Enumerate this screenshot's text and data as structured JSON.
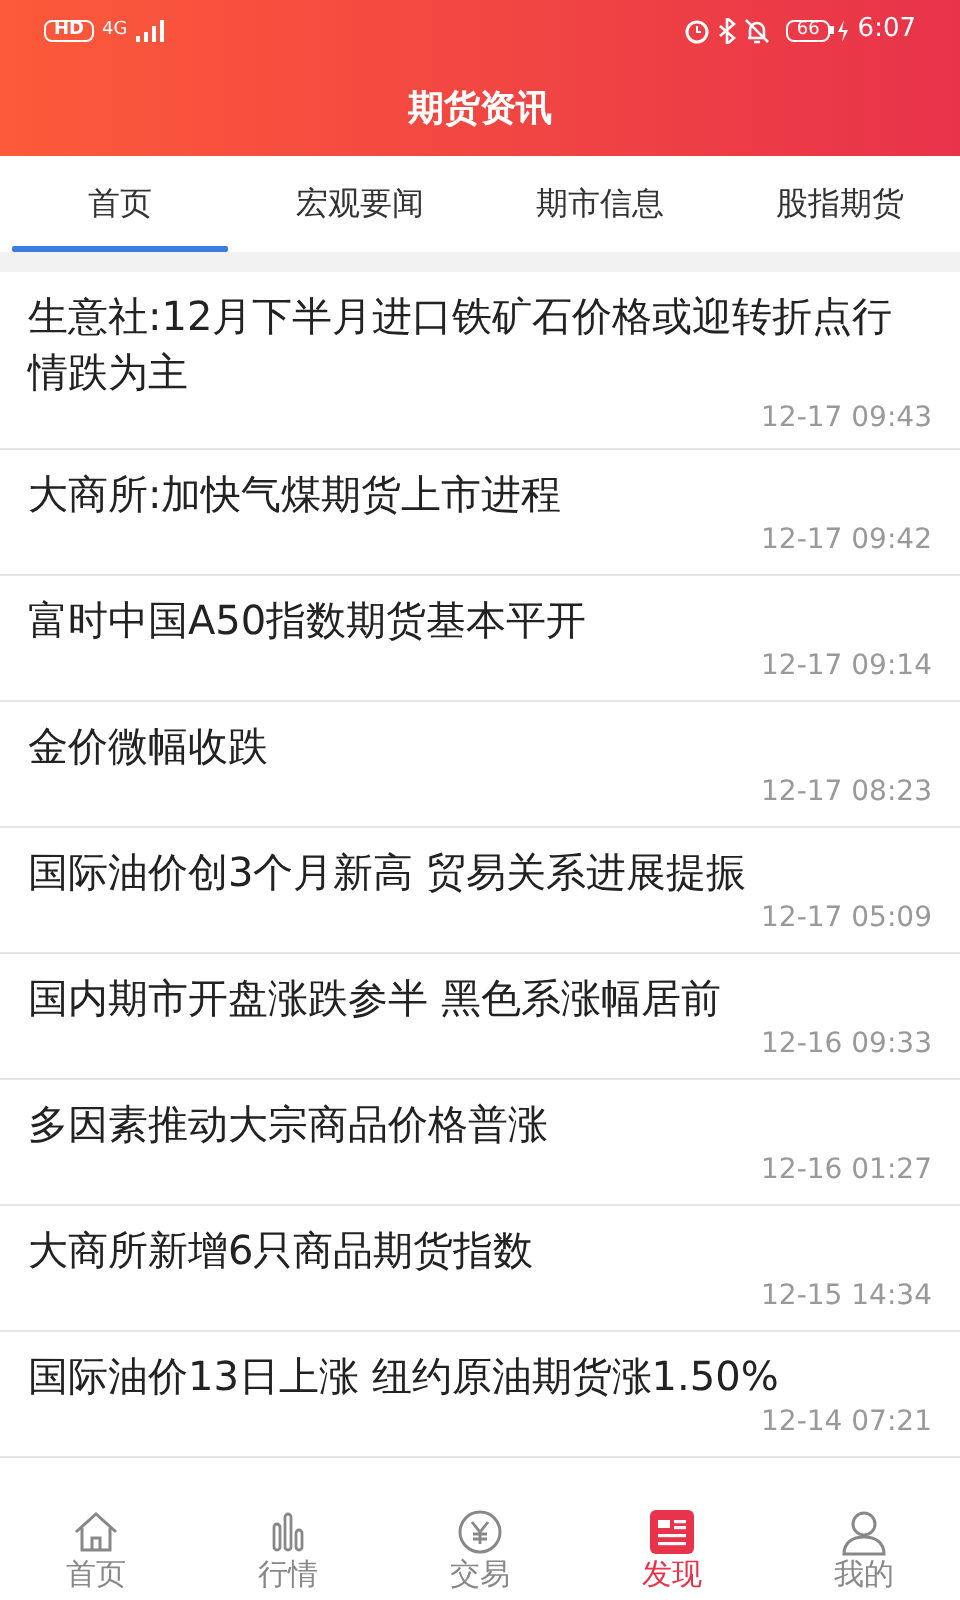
{
  "status_bar": {
    "left": "HD",
    "network": "4G",
    "time": "6:07",
    "battery": "66"
  },
  "header": {
    "title": "期货资讯"
  },
  "tabs": [
    {
      "label": "首页",
      "selected": true
    },
    {
      "label": "宏观要闻",
      "selected": false
    },
    {
      "label": "期市信息",
      "selected": false
    },
    {
      "label": "股指期货",
      "selected": false
    }
  ],
  "news": [
    {
      "title": "生意社:12月下半月进口铁矿石价格或迎转折点行情跌为主",
      "time": "12-17 09:43"
    },
    {
      "title": "大商所:加快气煤期货上市进程",
      "time": "12-17 09:42"
    },
    {
      "title": "富时中国A50指数期货基本平开",
      "time": "12-17 09:14"
    },
    {
      "title": "金价微幅收跌",
      "time": "12-17 08:23"
    },
    {
      "title": "国际油价创3个月新高 贸易关系进展提振",
      "time": "12-17 05:09"
    },
    {
      "title": "国内期市开盘涨跌参半 黑色系涨幅居前",
      "time": "12-16 09:33"
    },
    {
      "title": "多因素推动大宗商品价格普涨",
      "time": "12-16 01:27"
    },
    {
      "title": "大商所新增6只商品期货指数",
      "time": "12-15 14:34"
    },
    {
      "title": "国际油价13日上涨 纽约原油期货涨1.50%",
      "time": "12-14 07:21"
    }
  ],
  "bottom_nav": [
    {
      "label": "首页",
      "selected": false
    },
    {
      "label": "行情",
      "selected": false
    },
    {
      "label": "交易",
      "selected": false
    },
    {
      "label": "发现",
      "selected": true
    },
    {
      "label": "我的",
      "selected": false
    }
  ]
}
